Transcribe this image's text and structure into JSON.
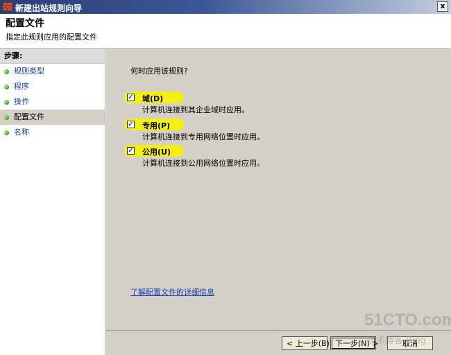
{
  "window": {
    "title": "新建出站规则向导",
    "close_label": "x"
  },
  "header": {
    "title": "配置文件",
    "subtitle": "指定此规则应用的配置文件"
  },
  "sidebar": {
    "steps_label": "步骤:",
    "items": [
      {
        "label": "规则类型"
      },
      {
        "label": "程序"
      },
      {
        "label": "操作"
      },
      {
        "label": "配置文件"
      },
      {
        "label": "名称"
      }
    ]
  },
  "main": {
    "question": "何时应用该规则?",
    "options": [
      {
        "label": "域(D)",
        "description": "计算机连接到其企业域时应用。",
        "checked": true
      },
      {
        "label": "专用(P)",
        "description": "计算机连接到专用网络位置时应用。",
        "checked": true
      },
      {
        "label": "公用(U)",
        "description": "计算机连接到公用网络位置时应用。",
        "checked": true
      }
    ],
    "learn_more_link": "了解配置文件的详细信息"
  },
  "footer": {
    "back_label": "< 上一步(B)",
    "next_label": "下一步(N) >",
    "cancel_label": "取消"
  },
  "watermark": {
    "main": "51CTO.com",
    "sub": "技术博客 Blog"
  },
  "colors": {
    "title_bar_start": "#2a3f73",
    "link": "#1a3fb0",
    "panel_bg": "#d4d0c8",
    "highlight": "#f6f200",
    "step_dot": "#2c9d1c"
  }
}
